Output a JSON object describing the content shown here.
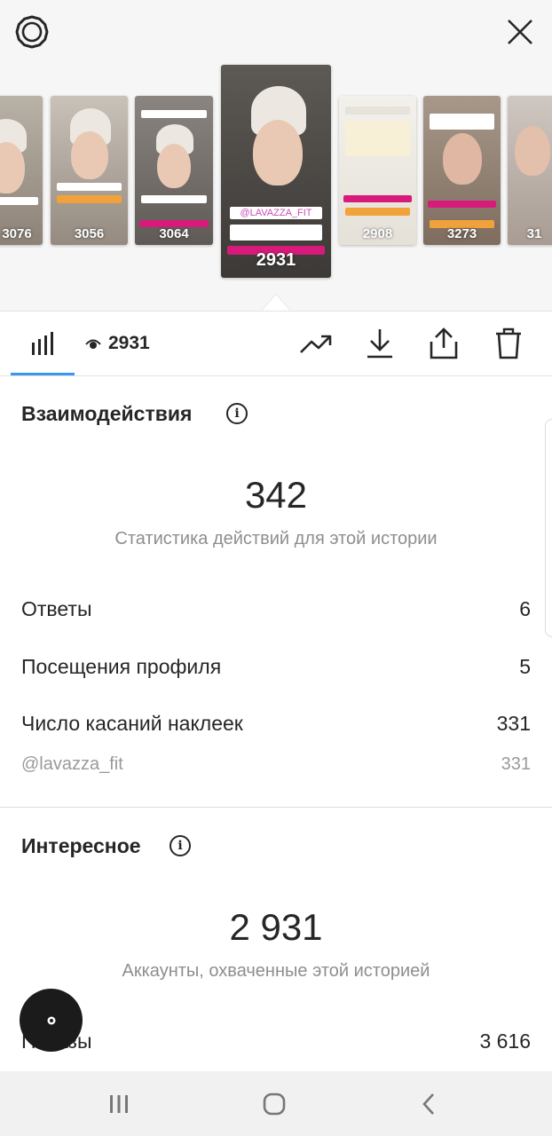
{
  "header": {
    "settings_icon": "gear-icon",
    "close_icon": "close-icon"
  },
  "stories": [
    {
      "views": "3076"
    },
    {
      "views": "3056"
    },
    {
      "views": "3064"
    },
    {
      "views": "2931",
      "selected": true,
      "caption": "@LAVAZZA_FIT"
    },
    {
      "views": "2908"
    },
    {
      "views": "3273"
    },
    {
      "views": "31"
    }
  ],
  "toolbar": {
    "insights_icon": "bar-chart-icon",
    "views_icon": "eye-icon",
    "views": "2931",
    "promote_icon": "trending-up-icon",
    "download_icon": "download-icon",
    "share_icon": "share-icon",
    "delete_icon": "trash-icon",
    "accent_color": "#3897f0"
  },
  "interactions": {
    "title": "Взаимодействия",
    "total": "342",
    "subtitle": "Статистика действий для этой истории",
    "rows": [
      {
        "label": "Ответы",
        "value": "6"
      },
      {
        "label": "Посещения профиля",
        "value": "5"
      },
      {
        "label": "Число касаний наклеек",
        "value": "331"
      }
    ],
    "sticker": {
      "label": "@lavazza_fit",
      "value": "331"
    }
  },
  "discovery": {
    "title": "Интересное",
    "total": "2 931",
    "subtitle": "Аккаунты, охваченные этой историей",
    "rows": [
      {
        "label": "Показы",
        "value": "3 616"
      }
    ]
  },
  "navbar": {
    "recents_icon": "recents-icon",
    "home_icon": "home-icon",
    "back_icon": "back-icon"
  }
}
